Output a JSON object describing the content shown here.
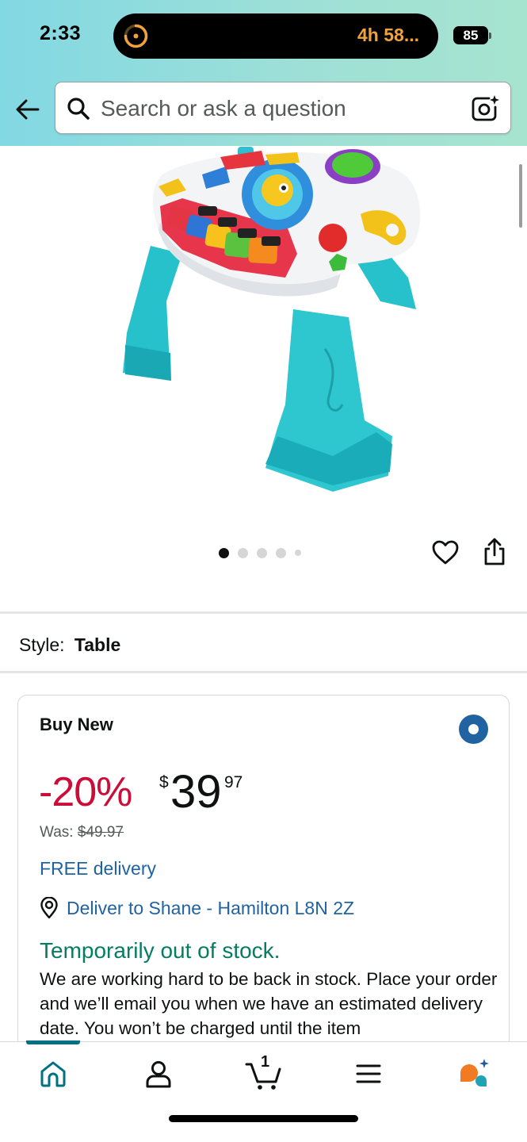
{
  "status_bar": {
    "time": "2:33",
    "activity_timer": "4h 58...",
    "battery": "85"
  },
  "search": {
    "placeholder": "Search or ask a question"
  },
  "gallery": {
    "image_count": 5,
    "active_index": 0
  },
  "style": {
    "label": "Style:",
    "value": "Table"
  },
  "buy_box": {
    "title": "Buy New",
    "discount": "-20%",
    "currency": "$",
    "price_whole": "39",
    "price_fraction": "97",
    "was_label": "Was:",
    "was_price": "$49.97",
    "free_delivery": "FREE delivery",
    "deliver_to": "Deliver to Shane - Hamilton L8N 2Z",
    "stock_status": "Temporarily out of stock.",
    "stock_message": "We are working hard to be back in stock. Place your order and we’ll email you when we have an estimated delivery date. You won’t be charged until the item"
  },
  "bottom_nav": {
    "cart_count": "1",
    "active_tab": "home"
  },
  "colors": {
    "header_gradient_start": "#82d8e3",
    "header_gradient_end": "#a6e4cf",
    "discount": "#cc0c39",
    "link": "#2162a1",
    "stock": "#067d62",
    "nav_active": "#007185",
    "assistant_orange": "#f07b22",
    "assistant_teal": "#1fa3b5"
  }
}
